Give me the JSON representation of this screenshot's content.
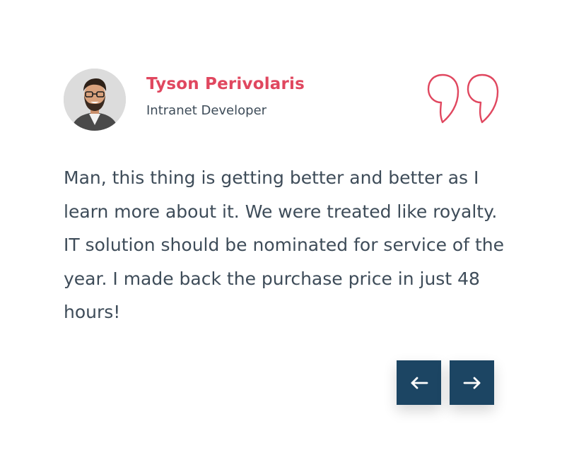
{
  "testimonial": {
    "name": "Tyson Perivolaris",
    "role": "Intranet Developer",
    "quote": "Man, this thing is getting better and better as I learn more about it. We were treated like royalty. IT solution should be nominated for service of the year. I made back the purchase price in just 48 hours!",
    "avatar_icon": "person-photo-icon",
    "quote_icon": "quote-mark-icon"
  },
  "navigation": {
    "prev_icon": "arrow-left-icon",
    "next_icon": "arrow-right-icon"
  },
  "colors": {
    "accent": "#e0475f",
    "text": "#3e4c59",
    "button_bg": "#1c4563",
    "button_icon": "#ffffff"
  }
}
